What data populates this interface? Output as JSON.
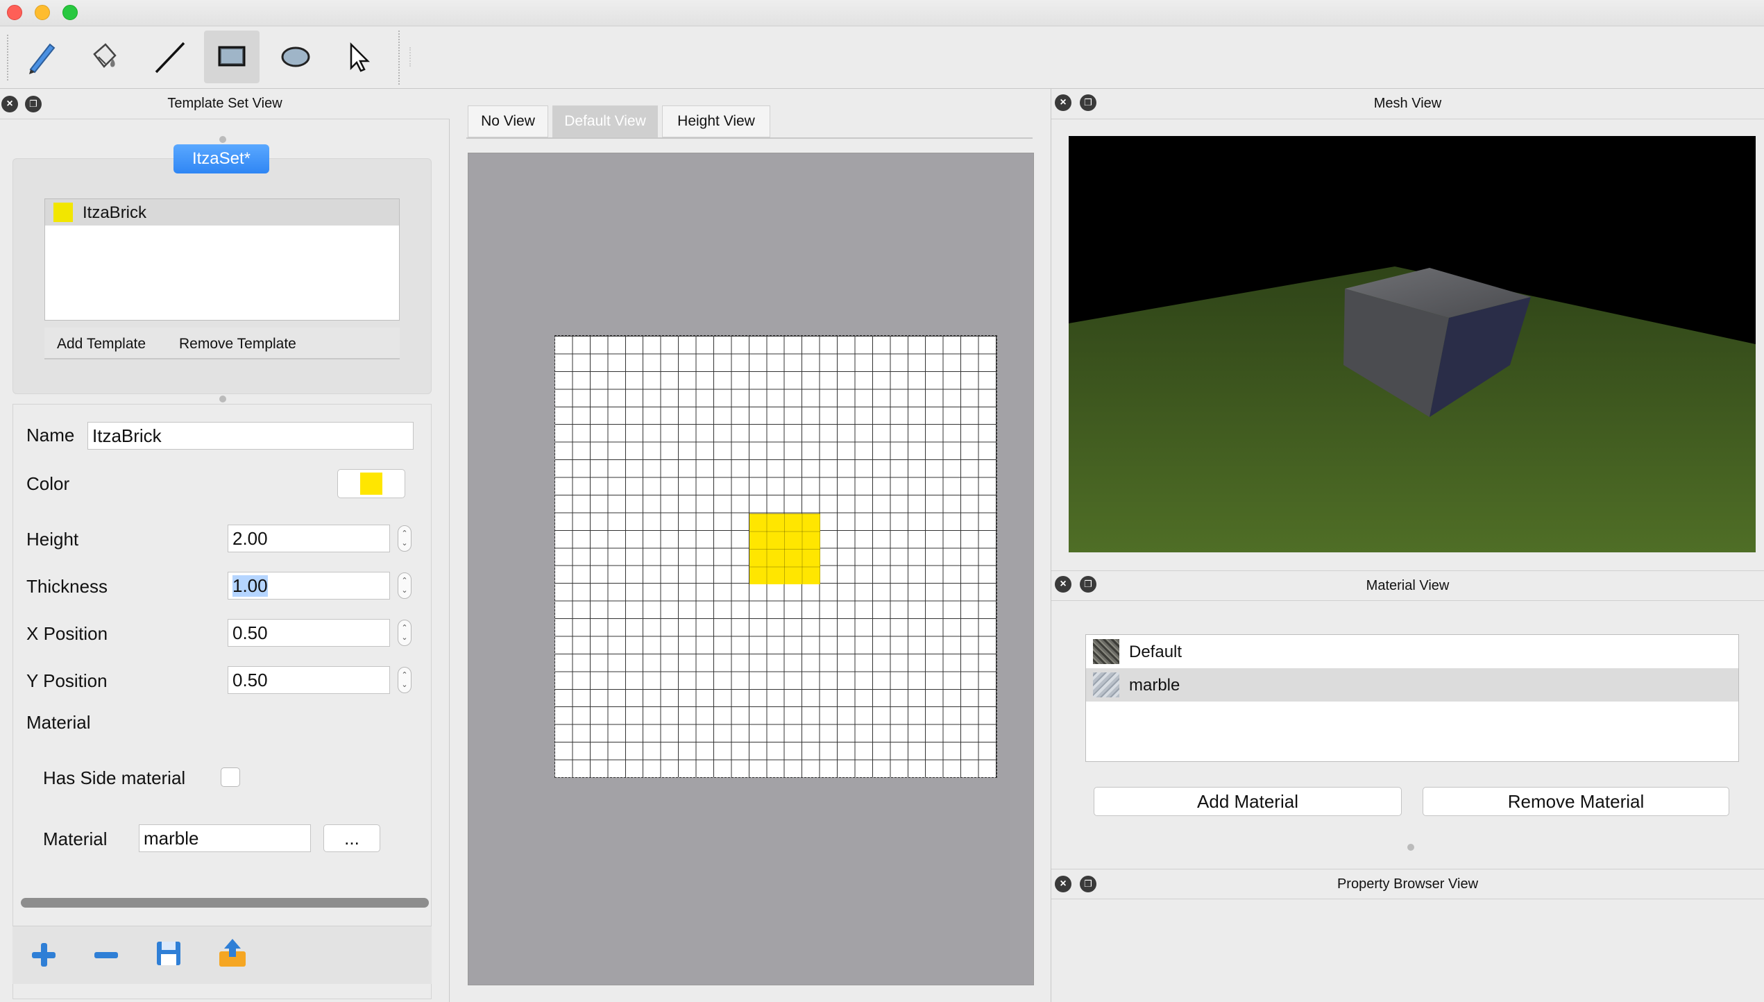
{
  "toolbar": {
    "tools": [
      "pencil-icon",
      "paint-bucket-icon",
      "line-icon",
      "rectangle-icon",
      "ellipse-icon",
      "pointer-icon"
    ],
    "active_tool": "rectangle-icon"
  },
  "template_set": {
    "title": "Template Set View",
    "set_name": "ItzaSet*",
    "templates": [
      {
        "name": "ItzaBrick",
        "color": "#f2e600"
      }
    ],
    "add_template": "Add Template",
    "remove_template": "Remove Template",
    "form": {
      "name_label": "Name",
      "name_value": "ItzaBrick",
      "color_label": "Color",
      "color_value": "#ffe600",
      "height_label": "Height",
      "height_value": "2.00",
      "thickness_label": "Thickness",
      "thickness_value": "1.00",
      "xpos_label": "X Position",
      "xpos_value": "0.50",
      "ypos_label": "Y Position",
      "ypos_value": "0.50",
      "material_section": "Material",
      "has_side_label": "Has Side material",
      "has_side_checked": false,
      "material_label": "Material",
      "material_value": "marble",
      "browse_label": "..."
    },
    "bottom_actions": [
      "add-icon",
      "remove-icon",
      "save-icon",
      "export-icon"
    ]
  },
  "center": {
    "tabs": [
      "No View",
      "Default View",
      "Height View"
    ],
    "selected_tab": "Default View"
  },
  "mesh_view": {
    "title": "Mesh View"
  },
  "material_view": {
    "title": "Material View",
    "materials": [
      "Default",
      "marble"
    ],
    "selected": "marble",
    "add_label": "Add Material",
    "remove_label": "Remove Material"
  },
  "property_browser": {
    "title": "Property Browser View"
  },
  "colors": {
    "accent": "#2f86f4",
    "brick": "#ffe600",
    "grass": "#3f5b1f"
  }
}
